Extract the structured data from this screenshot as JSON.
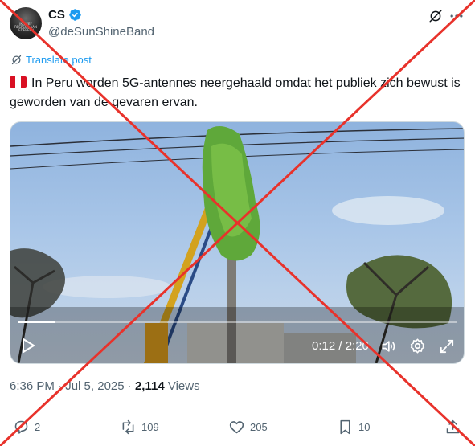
{
  "author": {
    "display_name": "CS",
    "handle": "@deSunShineBand",
    "avatar_text": "IK GEEF RESPECT AAN IEDEREEN"
  },
  "translate": {
    "label": "Translate post"
  },
  "tweet": {
    "flag": "peru-flag",
    "text": "In Peru worden 5G-antennes neergehaald omdat het publiek zich bewust is geworden van de gevaren ervan."
  },
  "video": {
    "timecode": "0:12 / 2:20",
    "progress": 0.086
  },
  "meta": {
    "time": "6:36 PM",
    "separator": "·",
    "date": "Jul 5, 2025",
    "views_count": "2,114",
    "views_label": "Views"
  },
  "actions": {
    "replies": "2",
    "reposts": "109",
    "likes": "205",
    "bookmarks": "10"
  },
  "colors": {
    "accent": "#1d9bf0",
    "secondary_text": "#536471",
    "overlay_cross": "#e8322b",
    "flag_red": "#d91023"
  },
  "icons": [
    "verified-icon",
    "grok-icon",
    "more-icon",
    "translate-icon",
    "play-icon",
    "volume-icon",
    "settings-icon",
    "fullscreen-icon",
    "reply-icon",
    "repost-icon",
    "like-icon",
    "bookmark-icon",
    "share-icon"
  ]
}
